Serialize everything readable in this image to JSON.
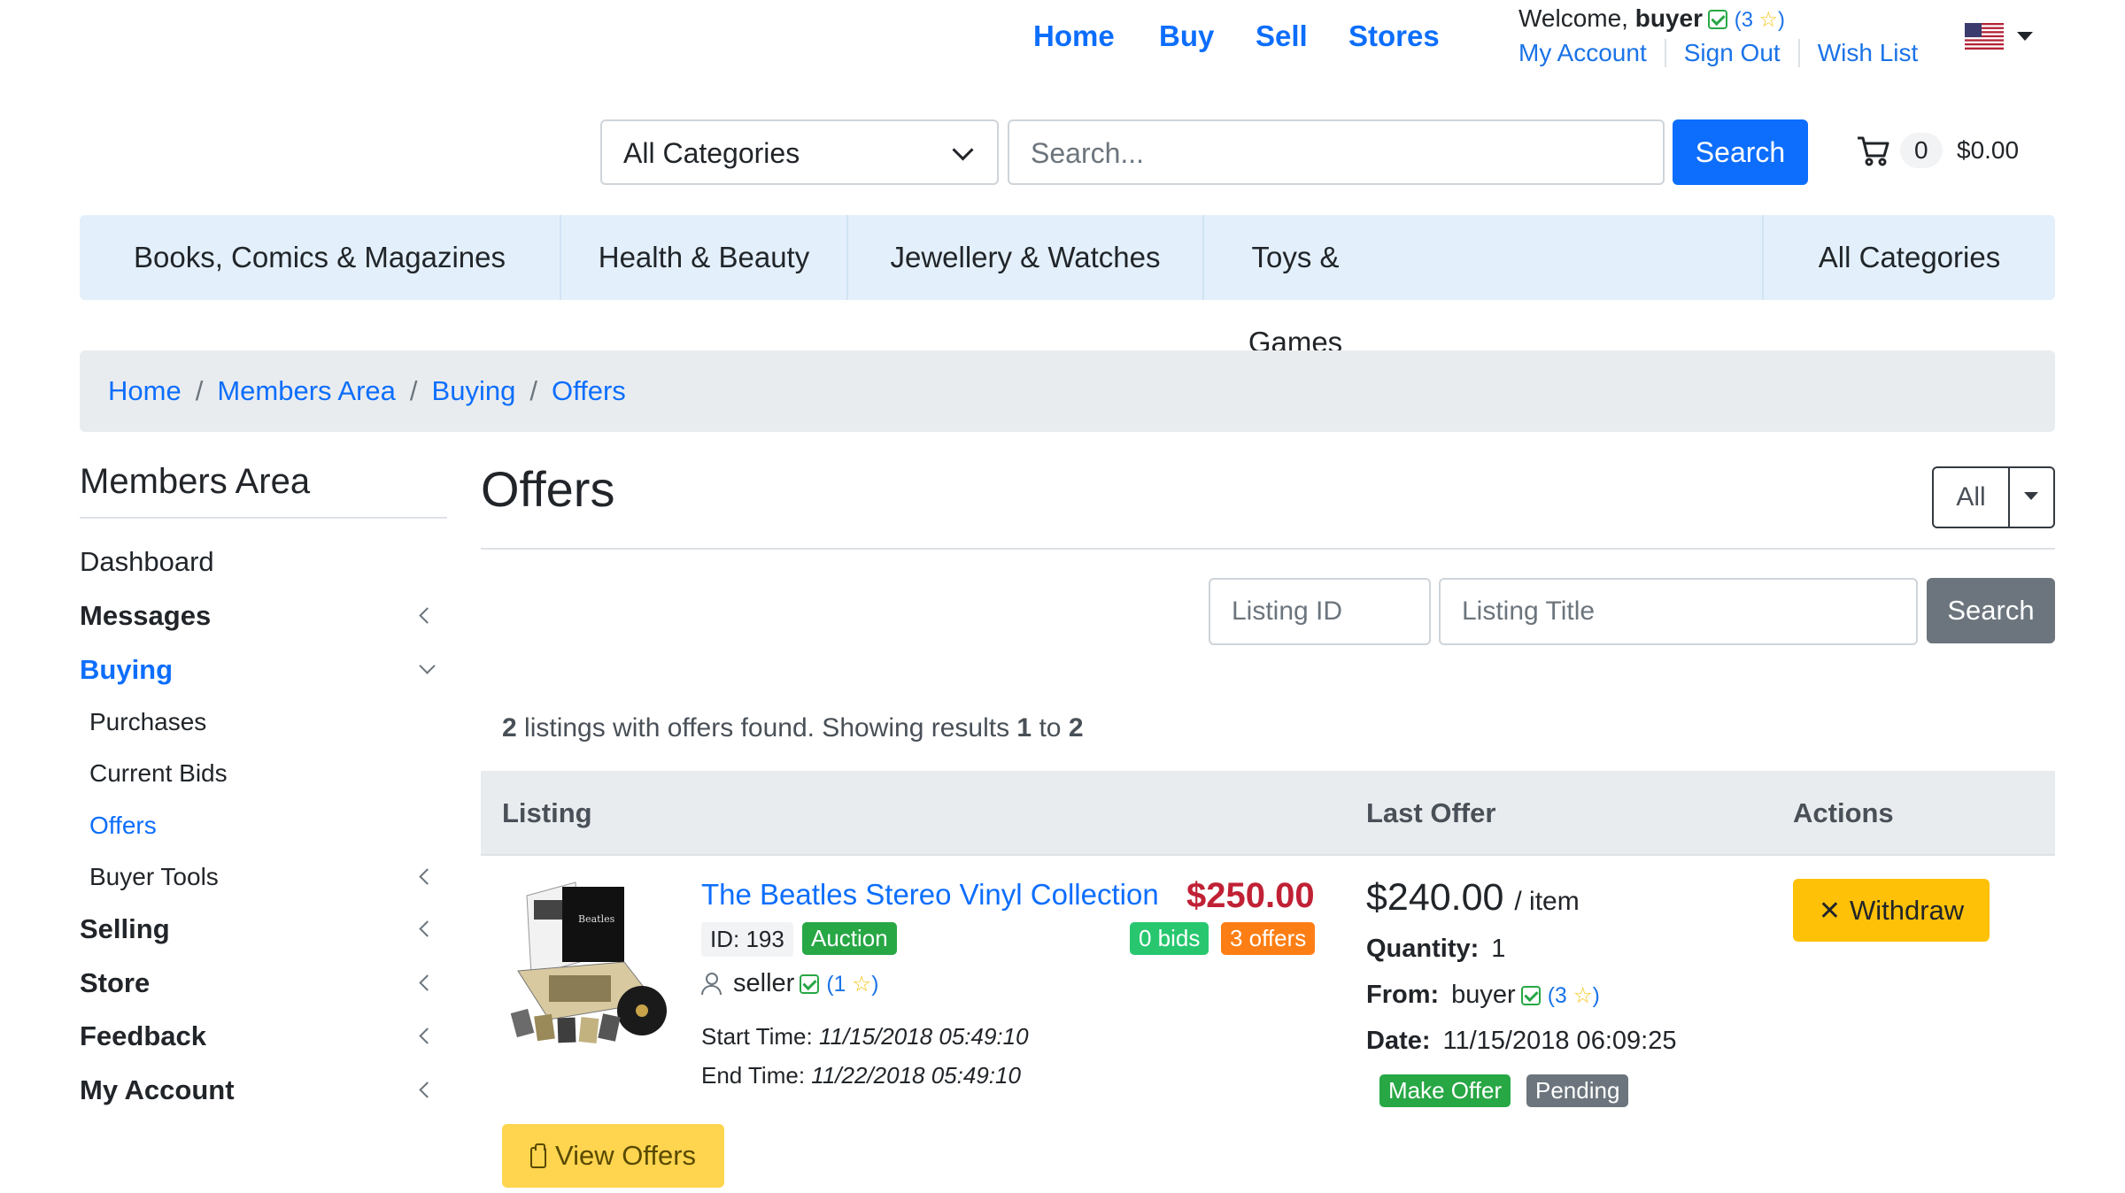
{
  "topnav": {
    "home": "Home",
    "buy": "Buy",
    "sell": "Sell",
    "stores": "Stores"
  },
  "account": {
    "welcome": "Welcome,",
    "username": "buyer",
    "feedback_open": "(",
    "feedback_count": "3",
    "feedback_close": ")",
    "links": [
      "My Account",
      "Sign Out",
      "Wish List"
    ],
    "flag": "us-flag-icon"
  },
  "search": {
    "category": "All Categories",
    "placeholder": "Search...",
    "button": "Search"
  },
  "cart": {
    "count": "0",
    "total": "$0.00"
  },
  "categories": [
    "Books, Comics & Magazines",
    "Health & Beauty",
    "Jewellery & Watches",
    "Toys & Games",
    "All Categories"
  ],
  "breadcrumb": [
    "Home",
    "Members Area",
    "Buying",
    "Offers"
  ],
  "sidebar": {
    "title": "Members Area",
    "items": [
      "Dashboard",
      "Messages",
      "Buying",
      "Purchases",
      "Current Bids",
      "Offers",
      "Buyer Tools",
      "Selling",
      "Store",
      "Feedback",
      "My Account"
    ]
  },
  "main": {
    "title": "Offers",
    "filter": "All",
    "listing_id_placeholder": "Listing ID",
    "listing_title_placeholder": "Listing Title",
    "search_button": "Search",
    "results": {
      "count": "2",
      "text1": " listings with offers found. Showing results ",
      "from": "1",
      "to_word": " to ",
      "to": "2"
    },
    "columns": [
      "Listing",
      "Last Offer",
      "Actions"
    ]
  },
  "row": {
    "title": "The Beatles Stereo Vinyl Collection",
    "price": "$250.00",
    "id_label": "ID: 193",
    "type_badge": "Auction",
    "bids_badge": "0 bids",
    "offers_badge": "3 offers",
    "seller": "seller",
    "seller_feedback": "1",
    "start_label": "Start Time:",
    "start_time": "11/15/2018 05:49:10",
    "end_label": "End Time:",
    "end_time": "11/22/2018 05:49:10",
    "offer_amount": "$240.00",
    "offer_unit": "/ item",
    "quantity_label": "Quantity:",
    "quantity": "1",
    "from_label": "From:",
    "from_user": "buyer",
    "from_feedback": "3",
    "date_label": "Date:",
    "date": "11/15/2018 06:09:25",
    "offer_type": "Make Offer",
    "status": "Pending",
    "withdraw": "Withdraw",
    "view_offers": "View Offers"
  },
  "colors": {
    "primary": "#0d6efd",
    "price_red": "#c02135",
    "success": "#28a745",
    "warning": "#ffc107",
    "orange": "#fd7e14",
    "secondary": "#6c757d"
  }
}
